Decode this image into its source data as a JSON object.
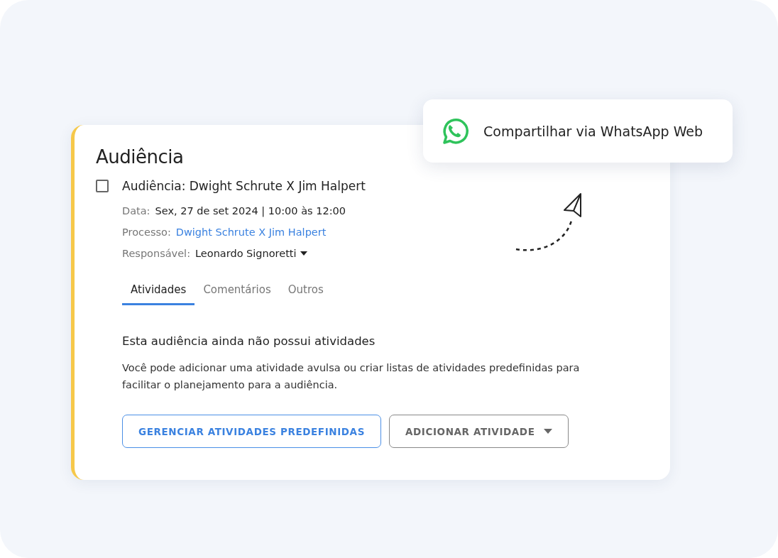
{
  "card": {
    "title": "Audiência",
    "task": {
      "checked": false,
      "title": "Audiência: Dwight Schrute X Jim Halpert"
    },
    "details": [
      {
        "label": "Data:",
        "value": "Sex, 27 de set 2024 | 10:00 às 12:00",
        "kind": "text"
      },
      {
        "label": "Processo:",
        "value": "Dwight Schrute X Jim Halpert",
        "kind": "link"
      },
      {
        "label": "Responsável:",
        "value": "Leonardo Signoretti",
        "kind": "dropdown"
      }
    ],
    "tabs": [
      {
        "label": "Atividades",
        "selected": true
      },
      {
        "label": "Comentários",
        "selected": false
      },
      {
        "label": "Outros",
        "selected": false
      }
    ],
    "empty_state": {
      "heading": "Esta audiência ainda não possui atividades",
      "text": "Você pode adicionar uma atividade avulsa ou criar listas de atividades predefinidas para facilitar o planejamento para a audiência."
    },
    "buttons": [
      {
        "label": "GERENCIAR ATIVIDADES PREDEFINIDAS",
        "kind": "primary"
      },
      {
        "label": "ADICIONAR ATIVIDADE",
        "kind": "dropdown"
      }
    ]
  },
  "share_popup": {
    "label": "Compartilhar via WhatsApp Web"
  }
}
